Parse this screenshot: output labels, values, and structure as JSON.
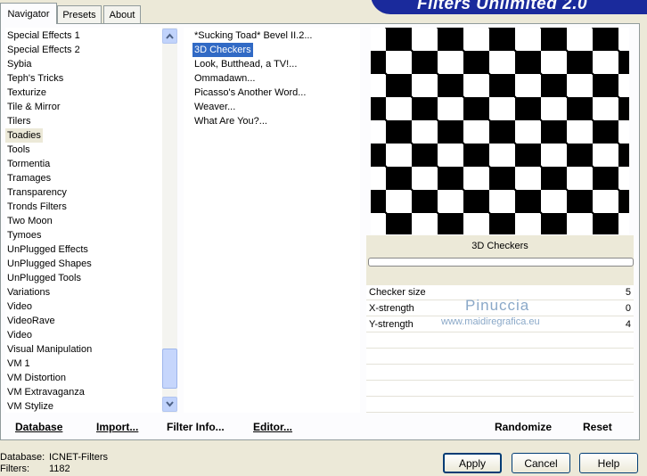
{
  "tabs": [
    "Navigator",
    "Presets",
    "About"
  ],
  "banner_title": "Filters Unlimited 2.0",
  "categories": [
    "Special Effects 1",
    "Special Effects 2",
    "Sybia",
    "Teph's Tricks",
    "Texturize",
    "Tile & Mirror",
    "Tilers",
    "Toadies",
    "Tools",
    "Tormentia",
    "Tramages",
    "Transparency",
    "Tronds Filters",
    "Two Moon",
    "Tymoes",
    "UnPlugged Effects",
    "UnPlugged Shapes",
    "UnPlugged Tools",
    "Variations",
    "Video",
    "VideoRave",
    "Video",
    "Visual Manipulation",
    "VM 1",
    "VM Distortion",
    "VM Extravaganza",
    "VM Stylize"
  ],
  "selected_category": "Toadies",
  "filters": [
    "*Sucking Toad*  Bevel II.2...",
    "3D Checkers",
    "Look, Butthead, a TV!...",
    "Ommadawn...",
    "Picasso's Another Word...",
    "Weaver...",
    "What Are You?..."
  ],
  "selected_filter": "3D Checkers",
  "preview_caption": "3D Checkers",
  "params": [
    {
      "label": "Checker size",
      "value": "5"
    },
    {
      "label": "X-strength",
      "value": "0"
    },
    {
      "label": "Y-strength",
      "value": "4"
    }
  ],
  "watermark": {
    "line1": "Pinuccia",
    "line2": "www.maidiregrafica.eu"
  },
  "bottom_buttons": {
    "database": "Database",
    "import": "Import...",
    "filter_info": "Filter Info...",
    "editor": "Editor...",
    "randomize": "Randomize",
    "reset": "Reset"
  },
  "status": {
    "database_label": "Database:",
    "database_value": "ICNET-Filters",
    "filters_label": "Filters:",
    "filters_value": "1182"
  },
  "dialog_buttons": {
    "apply": "Apply",
    "cancel": "Cancel",
    "help": "Help"
  },
  "colors": {
    "selection": "#316ac5",
    "banner": "#1a2a9c",
    "background": "#ece9d8"
  }
}
